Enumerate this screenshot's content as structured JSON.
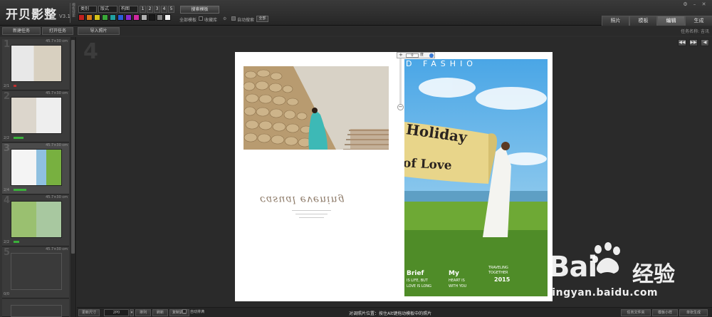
{
  "app": {
    "logo": "开贝影整",
    "version": "V3.1",
    "vertical_label": "模板搜索"
  },
  "toolbar": {
    "dropdowns": [
      "类别",
      "版式",
      "构图"
    ],
    "numbers": [
      "1",
      "2",
      "3",
      "4",
      "5"
    ],
    "swatch_colors": [
      "#c02020",
      "#d87a1a",
      "#d4c21a",
      "#3aa83a",
      "#20a0a0",
      "#2a5fd8",
      "#8a2ad0",
      "#d02aa0",
      "#b0b0b0",
      "#1a1a1a",
      "#808080",
      "#f0f0f0"
    ],
    "search_template_label": "搜索模板",
    "all_templates_label": "全部模板",
    "collect_label": "收藏库",
    "auto_search_label": "自动搜索",
    "all_label": "全部"
  },
  "main_tabs": [
    {
      "label": "照片",
      "active": false
    },
    {
      "label": "模板",
      "active": false
    },
    {
      "label": "编辑",
      "active": true
    },
    {
      "label": "生成",
      "active": false
    }
  ],
  "subbar": {
    "new_task_label": "新建任务",
    "open_task_label": "打开任务",
    "import_photo_label": "导入照片",
    "task_name_label": "任务名称: 吉讯"
  },
  "pages": [
    {
      "num": "1",
      "size": "45.7×30 cm",
      "count": "2/1",
      "active": false
    },
    {
      "num": "2",
      "size": "45.7×30 cm",
      "count": "2/2",
      "active": false
    },
    {
      "num": "3",
      "size": "45.7×30 cm",
      "count": "2/4",
      "active": true
    },
    {
      "num": "4",
      "size": "45.7×30 cm",
      "count": "2/2",
      "active": false
    },
    {
      "num": "5",
      "size": "45.7×30 cm",
      "count": "0/0",
      "active": false
    }
  ],
  "canvas": {
    "big_page_number": "4",
    "nav_arrows": [
      "◀◀",
      "▶▶",
      "◀"
    ],
    "script_text": "casual evening",
    "photo_toolbar": {
      "plus": "+",
      "zoom_value": "0",
      "unit": "度",
      "minus": "−"
    }
  },
  "right_photo": {
    "top_text": "D   FASHIO",
    "banner_text_1": "Holiday",
    "banner_text_2": "of Love",
    "brief": "Brief",
    "brief_line1": "IS LIFE, BUT",
    "brief_line2": "LOVE IS LONG",
    "my": "My",
    "my_line1": "HEART IS",
    "my_line2": "WITH YOU",
    "travel_1": "TRAVELING",
    "travel_2": "TOGETHER",
    "year": "2015"
  },
  "bottombar": {
    "page_size_label": "更新尺寸",
    "page_value": "2P0",
    "merge_label": "排列",
    "refresh_label": "刷新",
    "copy_label": "复制调整",
    "auto_arrange_label": "自动排满",
    "status_text": "对调照片位置：按住Alt键拖动模板中的照片",
    "task_files_label": "任务文件夹",
    "small_tpl_label": "模板小样",
    "generate_label": "单张生成"
  },
  "watermark": {
    "brand_left": "Bai",
    "brand_right": "经验",
    "url": "jingyan.baidu.com"
  }
}
